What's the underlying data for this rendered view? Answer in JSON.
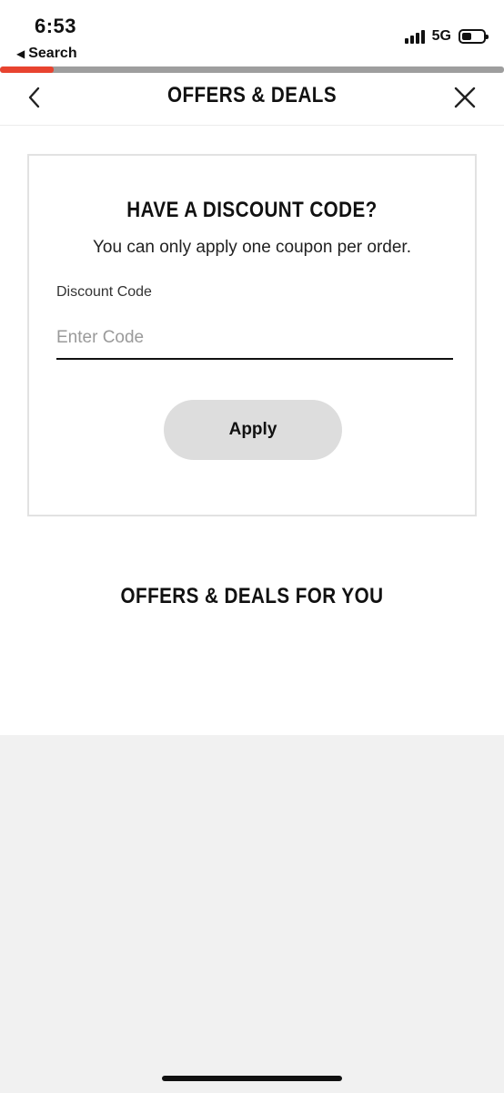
{
  "status_bar": {
    "time": "6:53",
    "back_label": "Search",
    "network": "5G"
  },
  "progress": {
    "fraction": 0.107,
    "color": "#e8432f",
    "track_color": "#9e9e9e"
  },
  "header": {
    "title": "OFFERS & DEALS",
    "back_icon": "chevron-left-icon",
    "close_icon": "close-icon"
  },
  "discount_card": {
    "title": "HAVE A DISCOUNT CODE?",
    "subtitle": "You can only apply one coupon per order.",
    "field_label": "Discount Code",
    "input_value": "",
    "input_placeholder": "Enter Code",
    "apply_label": "Apply"
  },
  "offers_section": {
    "title": "OFFERS & DEALS FOR YOU"
  },
  "colors": {
    "background": "#ffffff",
    "lower_background": "#f1f1f1",
    "button_bg": "#dddddd",
    "text": "#111111"
  }
}
